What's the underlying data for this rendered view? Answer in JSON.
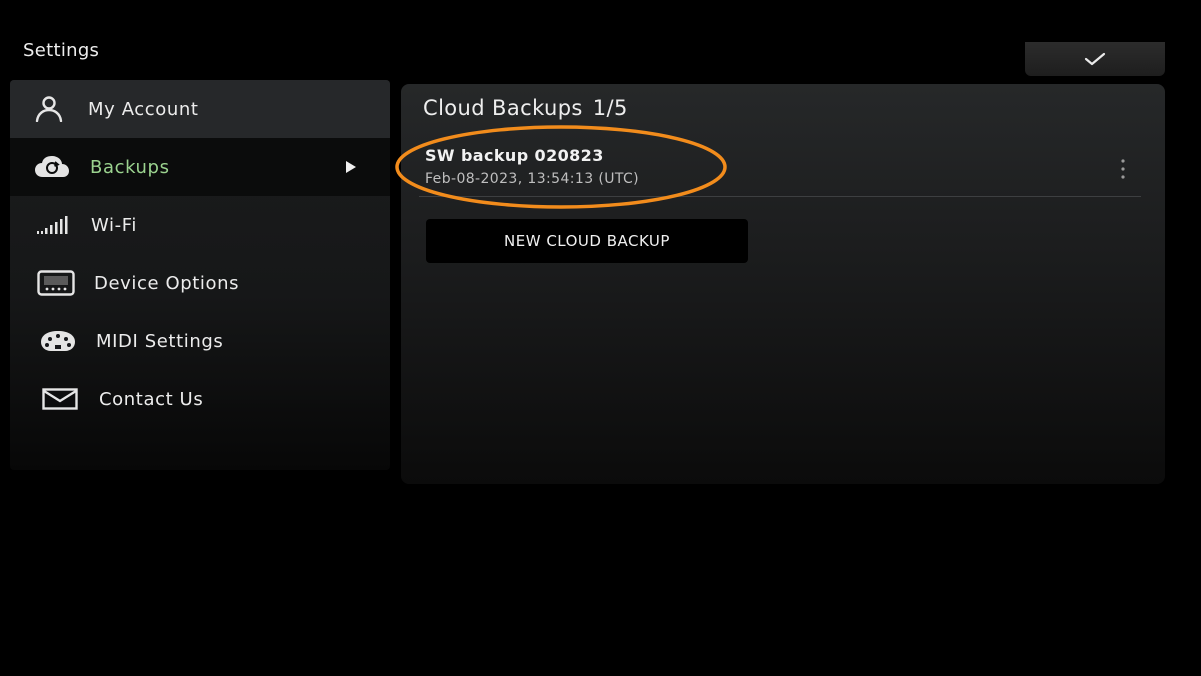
{
  "header": {
    "title": "Settings"
  },
  "confirm": {
    "icon": "checkmark-icon"
  },
  "sidebar": {
    "items": [
      {
        "label": "My Account",
        "icon": "user-icon",
        "state": "default"
      },
      {
        "label": "Backups",
        "icon": "cloud-sync-icon",
        "state": "active"
      },
      {
        "label": "Wi-Fi",
        "icon": "wifi-signal-icon",
        "state": "default"
      },
      {
        "label": "Device Options",
        "icon": "device-icon",
        "state": "default"
      },
      {
        "label": "MIDI Settings",
        "icon": "midi-icon",
        "state": "default"
      },
      {
        "label": "Contact Us",
        "icon": "mail-icon",
        "state": "default"
      }
    ]
  },
  "main": {
    "title": "Cloud Backups",
    "count": "1/5",
    "backups": [
      {
        "name": "SW backup 020823",
        "date": "Feb-08-2023, 13:54:13 (UTC)"
      }
    ],
    "new_backup_label": "NEW CLOUD BACKUP"
  },
  "colors": {
    "background": "#000000",
    "active_label": "#9bd38f",
    "highlight": "#f28c1c"
  }
}
